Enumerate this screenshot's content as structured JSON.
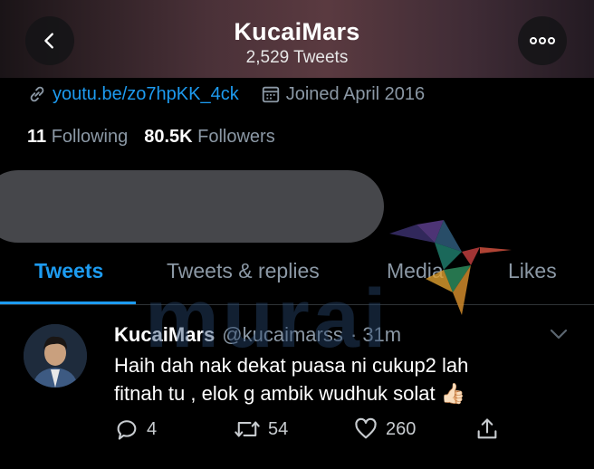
{
  "header": {
    "title": "KucaiMars",
    "tweet_count": "2,529 Tweets"
  },
  "profile": {
    "link": "youtu.be/zo7hpKK_4ck",
    "joined": "Joined April 2016",
    "following_count": "11",
    "following_label": "Following",
    "followers_count": "80.5K",
    "followers_label": "Followers"
  },
  "tabs": [
    {
      "label": "Tweets",
      "active": true
    },
    {
      "label": "Tweets & replies",
      "active": false
    },
    {
      "label": "Media",
      "active": false
    },
    {
      "label": "Likes",
      "active": false
    }
  ],
  "tweet": {
    "name": "KucaiMars",
    "handle": "@kucaimarss",
    "time": "· 31m",
    "line1": "Haih dah nak dekat puasa ni cukup2 lah",
    "line2": "fitnah tu , elok g ambik wudhuk solat",
    "emoji": "👍🏻",
    "replies": "4",
    "retweets": "54",
    "likes": "260"
  },
  "watermark": "murai",
  "colors": {
    "accent": "#1d9bf0",
    "muted": "#8b98a5",
    "background": "#000000"
  }
}
